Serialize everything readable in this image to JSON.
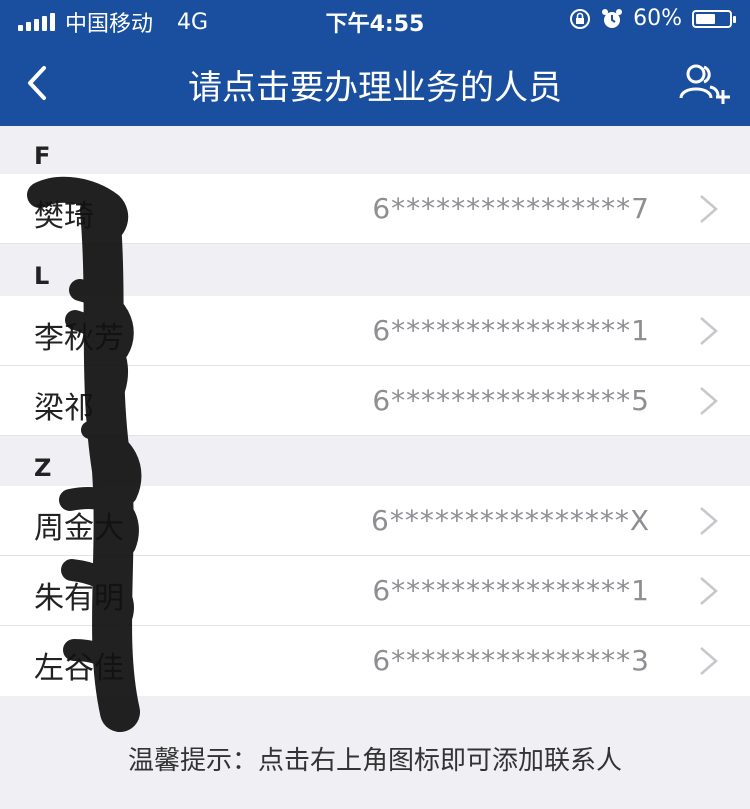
{
  "status_bar": {
    "carrier": "中国移动",
    "network": "4G",
    "time": "下午4:55",
    "battery_percent": "60%",
    "battery_level": 0.6
  },
  "nav": {
    "title": "请点击要办理业务的人员",
    "back_icon": "chevron-left-icon",
    "add_icon": "add-contact-icon"
  },
  "sections": [
    {
      "letter": "F",
      "rows": [
        {
          "name": "樊琦",
          "id": "6****************7"
        }
      ]
    },
    {
      "letter": "L",
      "rows": [
        {
          "name": "李秋芳",
          "id": "6****************1"
        },
        {
          "name": "梁祁",
          "id": "6****************5"
        }
      ]
    },
    {
      "letter": "Z",
      "rows": [
        {
          "name": "周金大",
          "id": "6****************X"
        },
        {
          "name": "朱有明",
          "id": "6****************1"
        },
        {
          "name": "左谷佳",
          "id": "6****************3"
        }
      ]
    }
  ],
  "footer": {
    "hint": "温馨提示：点击右上角图标即可添加联系人"
  },
  "colors": {
    "nav_bg": "#1a4fa0",
    "page_bg": "#efeff4"
  }
}
